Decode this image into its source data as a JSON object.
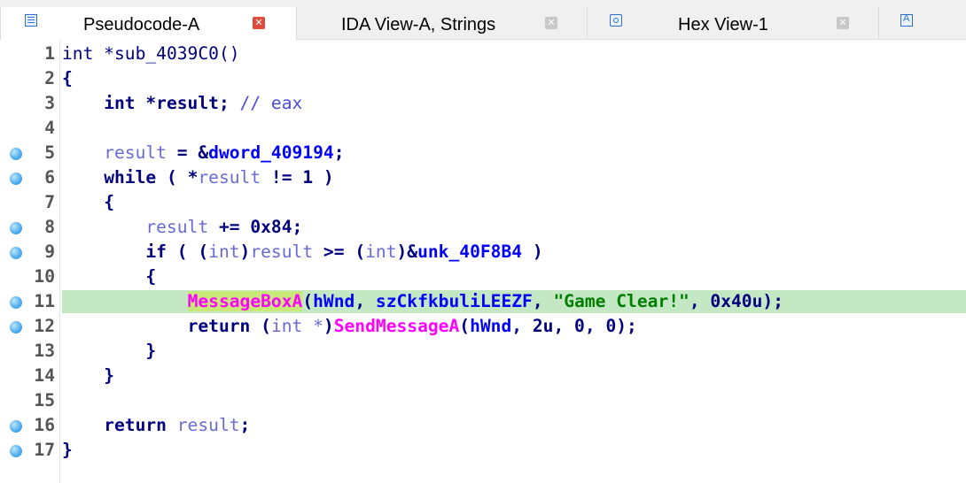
{
  "tabs": [
    {
      "label": "Pseudocode-A",
      "active": true,
      "icon": "pseudocode-icon",
      "close_color": "#e04a3a"
    },
    {
      "label": "IDA View-A, Strings",
      "active": false,
      "icon": "none",
      "close_color": "#c8c8c8"
    },
    {
      "label": "Hex View-1",
      "active": false,
      "icon": "hex-view-icon",
      "close_color": "#c8c8c8"
    },
    {
      "label": "",
      "active": false,
      "icon": "local-types-icon"
    }
  ],
  "colors": {
    "keyword": "#00007f",
    "local_var": "#6a6ad6",
    "global": "#0000ff",
    "function": "#ff00ff",
    "string": "#007f00",
    "line_highlight": "#c4e7c4",
    "token_highlight": "#c8e878"
  },
  "code": {
    "line_numbers": [
      "1",
      "2",
      "3",
      "4",
      "5",
      "6",
      "7",
      "8",
      "9",
      "10",
      "11",
      "12",
      "13",
      "14",
      "15",
      "16",
      "17"
    ],
    "breakpoint_lines": [
      5,
      6,
      8,
      9,
      11,
      12,
      16,
      17
    ],
    "highlighted_line": 11,
    "t": {
      "int": "int",
      "ptr": " *",
      "sub": "sub_4039C0",
      "parens": "()",
      "lbrace": "{",
      "rbrace": "}",
      "result": "result",
      "semicolon": ";",
      "comment": "// eax",
      "assign": " = ",
      "amp": "&",
      "dword": "dword_409194",
      "while": "while",
      "open": " ( ",
      "deref": "*",
      "ne": " != ",
      "one": "1",
      "close": " )",
      "pluseq": " += ",
      "hex84": "0x84",
      "if": "if",
      "cast_open": "(",
      "cast_close": ")",
      "ge": " >= ",
      "unk": "unk_40F8B4",
      "msgbox": "MessageBoxA",
      "hwnd": "hWnd",
      "comma": ", ",
      "caption": "szCkfkbuliLEEZF",
      "str": "\"Game Clear!\"",
      "hex40": "0x40u",
      "return": "return",
      "cast_ptr": "int *",
      "sendmsg": "SendMessageA",
      "two": "2u",
      "zero": "0",
      "rparen": ")"
    }
  }
}
